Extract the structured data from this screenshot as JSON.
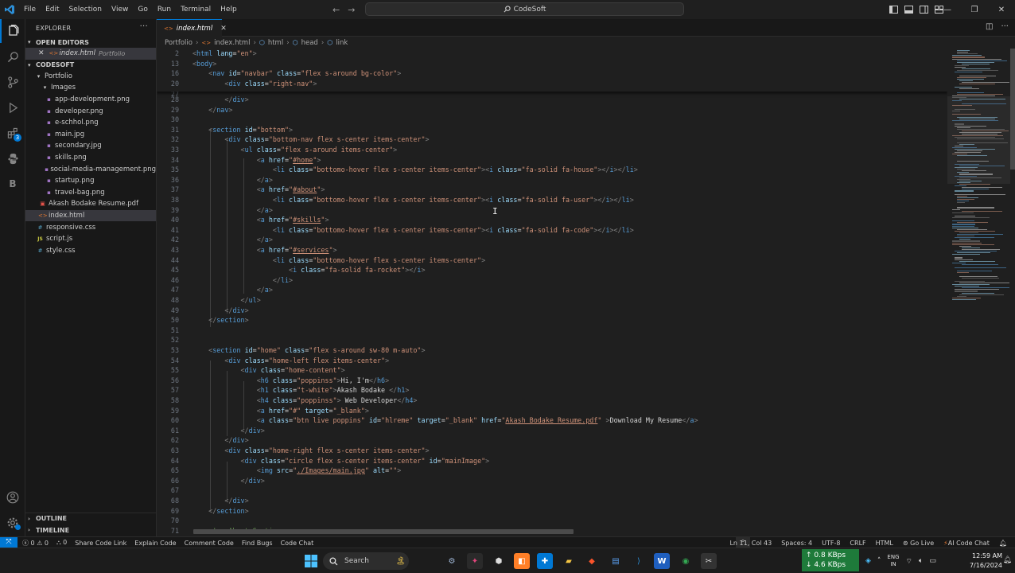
{
  "titlebar": {
    "menu": [
      "File",
      "Edit",
      "Selection",
      "View",
      "Go",
      "Run",
      "Terminal",
      "Help"
    ],
    "search_text": "CodeSoft"
  },
  "explorer": {
    "header": "EXPLORER",
    "open_editors_label": "OPEN EDITORS",
    "open_editor": {
      "name": "index.html",
      "folder": "Portfolio"
    },
    "workspace_label": "CODESOFT",
    "folder_portfolio": "Portfolio",
    "folder_images": "Images",
    "images": [
      "app-development.png",
      "developer.png",
      "e-schhol.png",
      "main.jpg",
      "secondary.jpg",
      "skills.png",
      "social-media-management.png",
      "startup.png",
      "travel-bag.png"
    ],
    "portfolio_files": [
      "Akash Bodake Resume.pdf",
      "index.html"
    ],
    "root_files": [
      "responsive.css",
      "script.js",
      "style.css"
    ],
    "outline_label": "OUTLINE",
    "timeline_label": "TIMELINE",
    "extensions_badge": "3"
  },
  "tab": {
    "name": "index.html"
  },
  "breadcrumb": [
    "Portfolio",
    "index.html",
    "html",
    "head",
    "link"
  ],
  "statusbar": {
    "errors": "0",
    "warnings": "0",
    "ports": "0",
    "left_items": [
      "Share Code Link",
      "Explain Code",
      "Comment Code",
      "Find Bugs",
      "Code Chat"
    ],
    "position": "Ln 11, Col 43",
    "spaces": "Spaces: 4",
    "encoding": "UTF-8",
    "eol": "CRLF",
    "language": "HTML",
    "golive": "Go Live",
    "aichat": "AI Code Chat"
  },
  "taskbar": {
    "search": "Search",
    "net_up": "0.8 KBps",
    "net_down": "4.6 KBps",
    "lang1": "ENG",
    "lang2": "IN",
    "time": "12:59 AM",
    "date": "7/16/2024"
  },
  "colors": {
    "accent": "#0078d4",
    "tag": "#569cd6",
    "attr": "#9cdcfe",
    "string": "#ce9178",
    "comment": "#6a9955"
  }
}
